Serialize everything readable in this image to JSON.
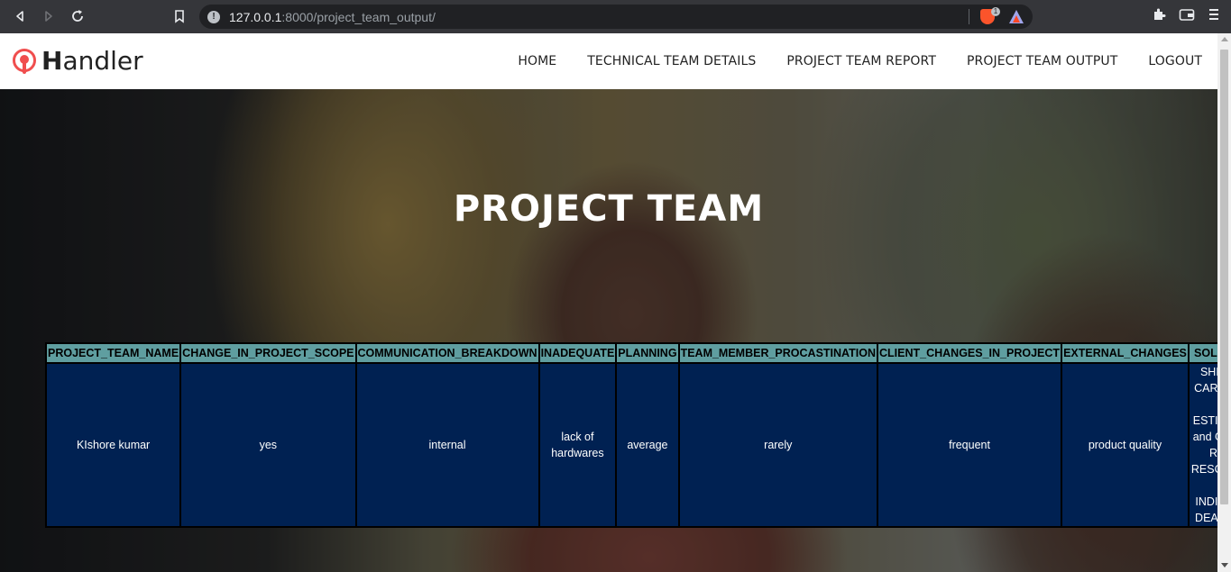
{
  "browser": {
    "url_host": "127.0.0.1",
    "url_rest": ":8000/project_team_output/",
    "brave_badge": "1",
    "icons": [
      "back-icon",
      "forward-icon",
      "reload-icon",
      "bookmark-icon",
      "site-info-icon",
      "brave-shields-icon",
      "brave-rewards-icon",
      "extensions-icon",
      "wallet-icon",
      "menu-icon"
    ]
  },
  "header": {
    "logo_first": "H",
    "logo_rest": "andler",
    "nav": [
      {
        "label": "HOME"
      },
      {
        "label": "TECHNICAL TEAM DETAILS"
      },
      {
        "label": "PROJECT TEAM REPORT"
      },
      {
        "label": "PROJECT TEAM OUTPUT"
      },
      {
        "label": "LOGOUT"
      }
    ]
  },
  "hero": {
    "title": "PROJECT TEAM"
  },
  "table": {
    "columns": [
      "PROJECT_TEAM_NAME",
      "CHANGE_IN_PROJECT_SCOPE",
      "COMMUNICATION_BREAKDOWN",
      "INADEQUATE",
      "PLANNING",
      "TEAM_MEMBER_PROCASTINATION",
      "CLIENT_CHANGES_IN_PROJECT",
      "EXTERNAL_CHANGES",
      "SOLUTIONS"
    ],
    "rows": [
      [
        "KIshore kumar",
        "yes",
        "internal",
        "lack of hardwares",
        "average",
        "rarely",
        "frequent",
        "product quality",
        "SHEDULE CAREFULLY and ESTIMATION and GATHER RIGHT RESOURCES and INDIVIDUAL DEADLINES"
      ]
    ]
  },
  "colors": {
    "header_cell": "#5f9ea0",
    "body_cell": "#002152",
    "logo_accent": "#f04e4e"
  }
}
